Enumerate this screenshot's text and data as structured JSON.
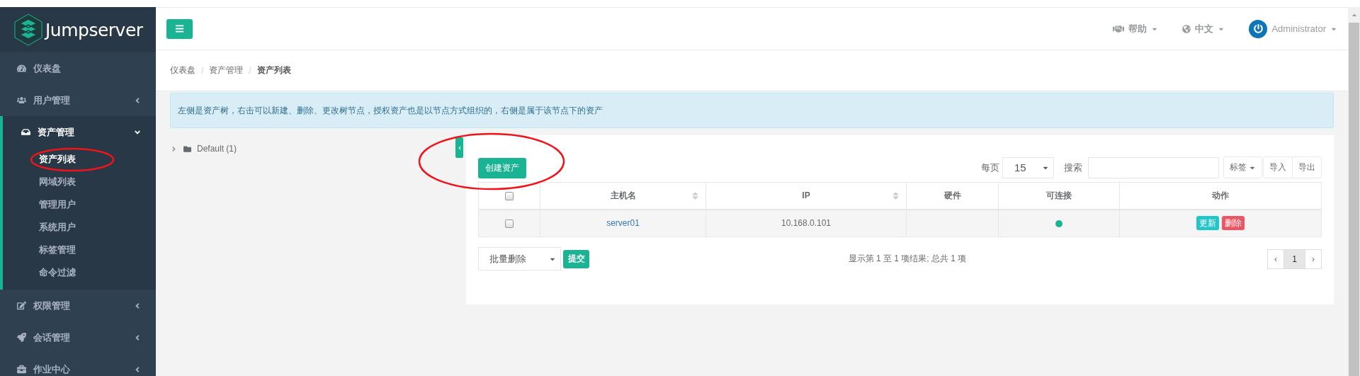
{
  "brand": {
    "name": "Jumpserver"
  },
  "sidebar": {
    "items": [
      {
        "label": "仪表盘",
        "kind": "link",
        "expanded": false
      },
      {
        "label": "用户管理",
        "kind": "group",
        "expanded": false
      },
      {
        "label": "资产管理",
        "kind": "group",
        "expanded": true,
        "children": [
          {
            "label": "资产列表",
            "selected": true,
            "circled": true
          },
          {
            "label": "网域列表",
            "selected": false,
            "circled": false
          },
          {
            "label": "管理用户",
            "selected": false,
            "circled": false
          },
          {
            "label": "系统用户",
            "selected": false,
            "circled": false
          },
          {
            "label": "标签管理",
            "selected": false,
            "circled": false
          },
          {
            "label": "命令过滤",
            "selected": false,
            "circled": false
          }
        ]
      },
      {
        "label": "权限管理",
        "kind": "group",
        "expanded": false
      },
      {
        "label": "会话管理",
        "kind": "group",
        "expanded": false
      },
      {
        "label": "作业中心",
        "kind": "group",
        "expanded": false
      }
    ]
  },
  "topbar": {
    "help": "帮助",
    "language": "中文",
    "user": "Administrator"
  },
  "breadcrumb": [
    {
      "label": "仪表盘",
      "current": false
    },
    {
      "separator": "/",
      "label": "资产管理",
      "current": false
    },
    {
      "separator": "/",
      "label": "资产列表",
      "current": true
    }
  ],
  "alert": "左侧是资产树，右击可以新建、删除、更改树节点，授权资产也是以节点方式组织的，右侧是属于该节点下的资产",
  "tree": [
    {
      "label": "Default (1)",
      "expanded": false
    }
  ],
  "panel": {
    "create_button": {
      "label": "创建资产",
      "circled": true
    },
    "page_size": {
      "label": "每页",
      "value": "15"
    },
    "search": {
      "label": "搜索"
    },
    "tag_button": "标签",
    "import_button": "导入",
    "export_button": "导出",
    "table": {
      "columns": [
        {
          "kind": "checkbox",
          "checked": false
        },
        {
          "kind": "text",
          "label": "主机名",
          "sortable": true
        },
        {
          "kind": "text",
          "label": "IP",
          "sortable": true
        },
        {
          "kind": "text",
          "label": "硬件",
          "sortable": false
        },
        {
          "kind": "text",
          "label": "可连接",
          "sortable": false
        },
        {
          "kind": "text",
          "label": "动作",
          "sortable": false
        }
      ],
      "rows": [
        {
          "checked": false,
          "hostname": "server01",
          "ip": "10.168.0.101",
          "connectable": true,
          "actions": [
            {
              "kind": "update",
              "label": "更新"
            },
            {
              "kind": "delete",
              "label": "删除"
            }
          ]
        }
      ]
    },
    "bulk_action": {
      "value": "批量删除",
      "submit": "提交"
    },
    "summary": "显示第 1 至 1 项结果; 总共 1 项",
    "pagination": {
      "prev": "‹",
      "pages": [
        {
          "label": "1",
          "selected": true
        }
      ],
      "next": "›"
    }
  }
}
